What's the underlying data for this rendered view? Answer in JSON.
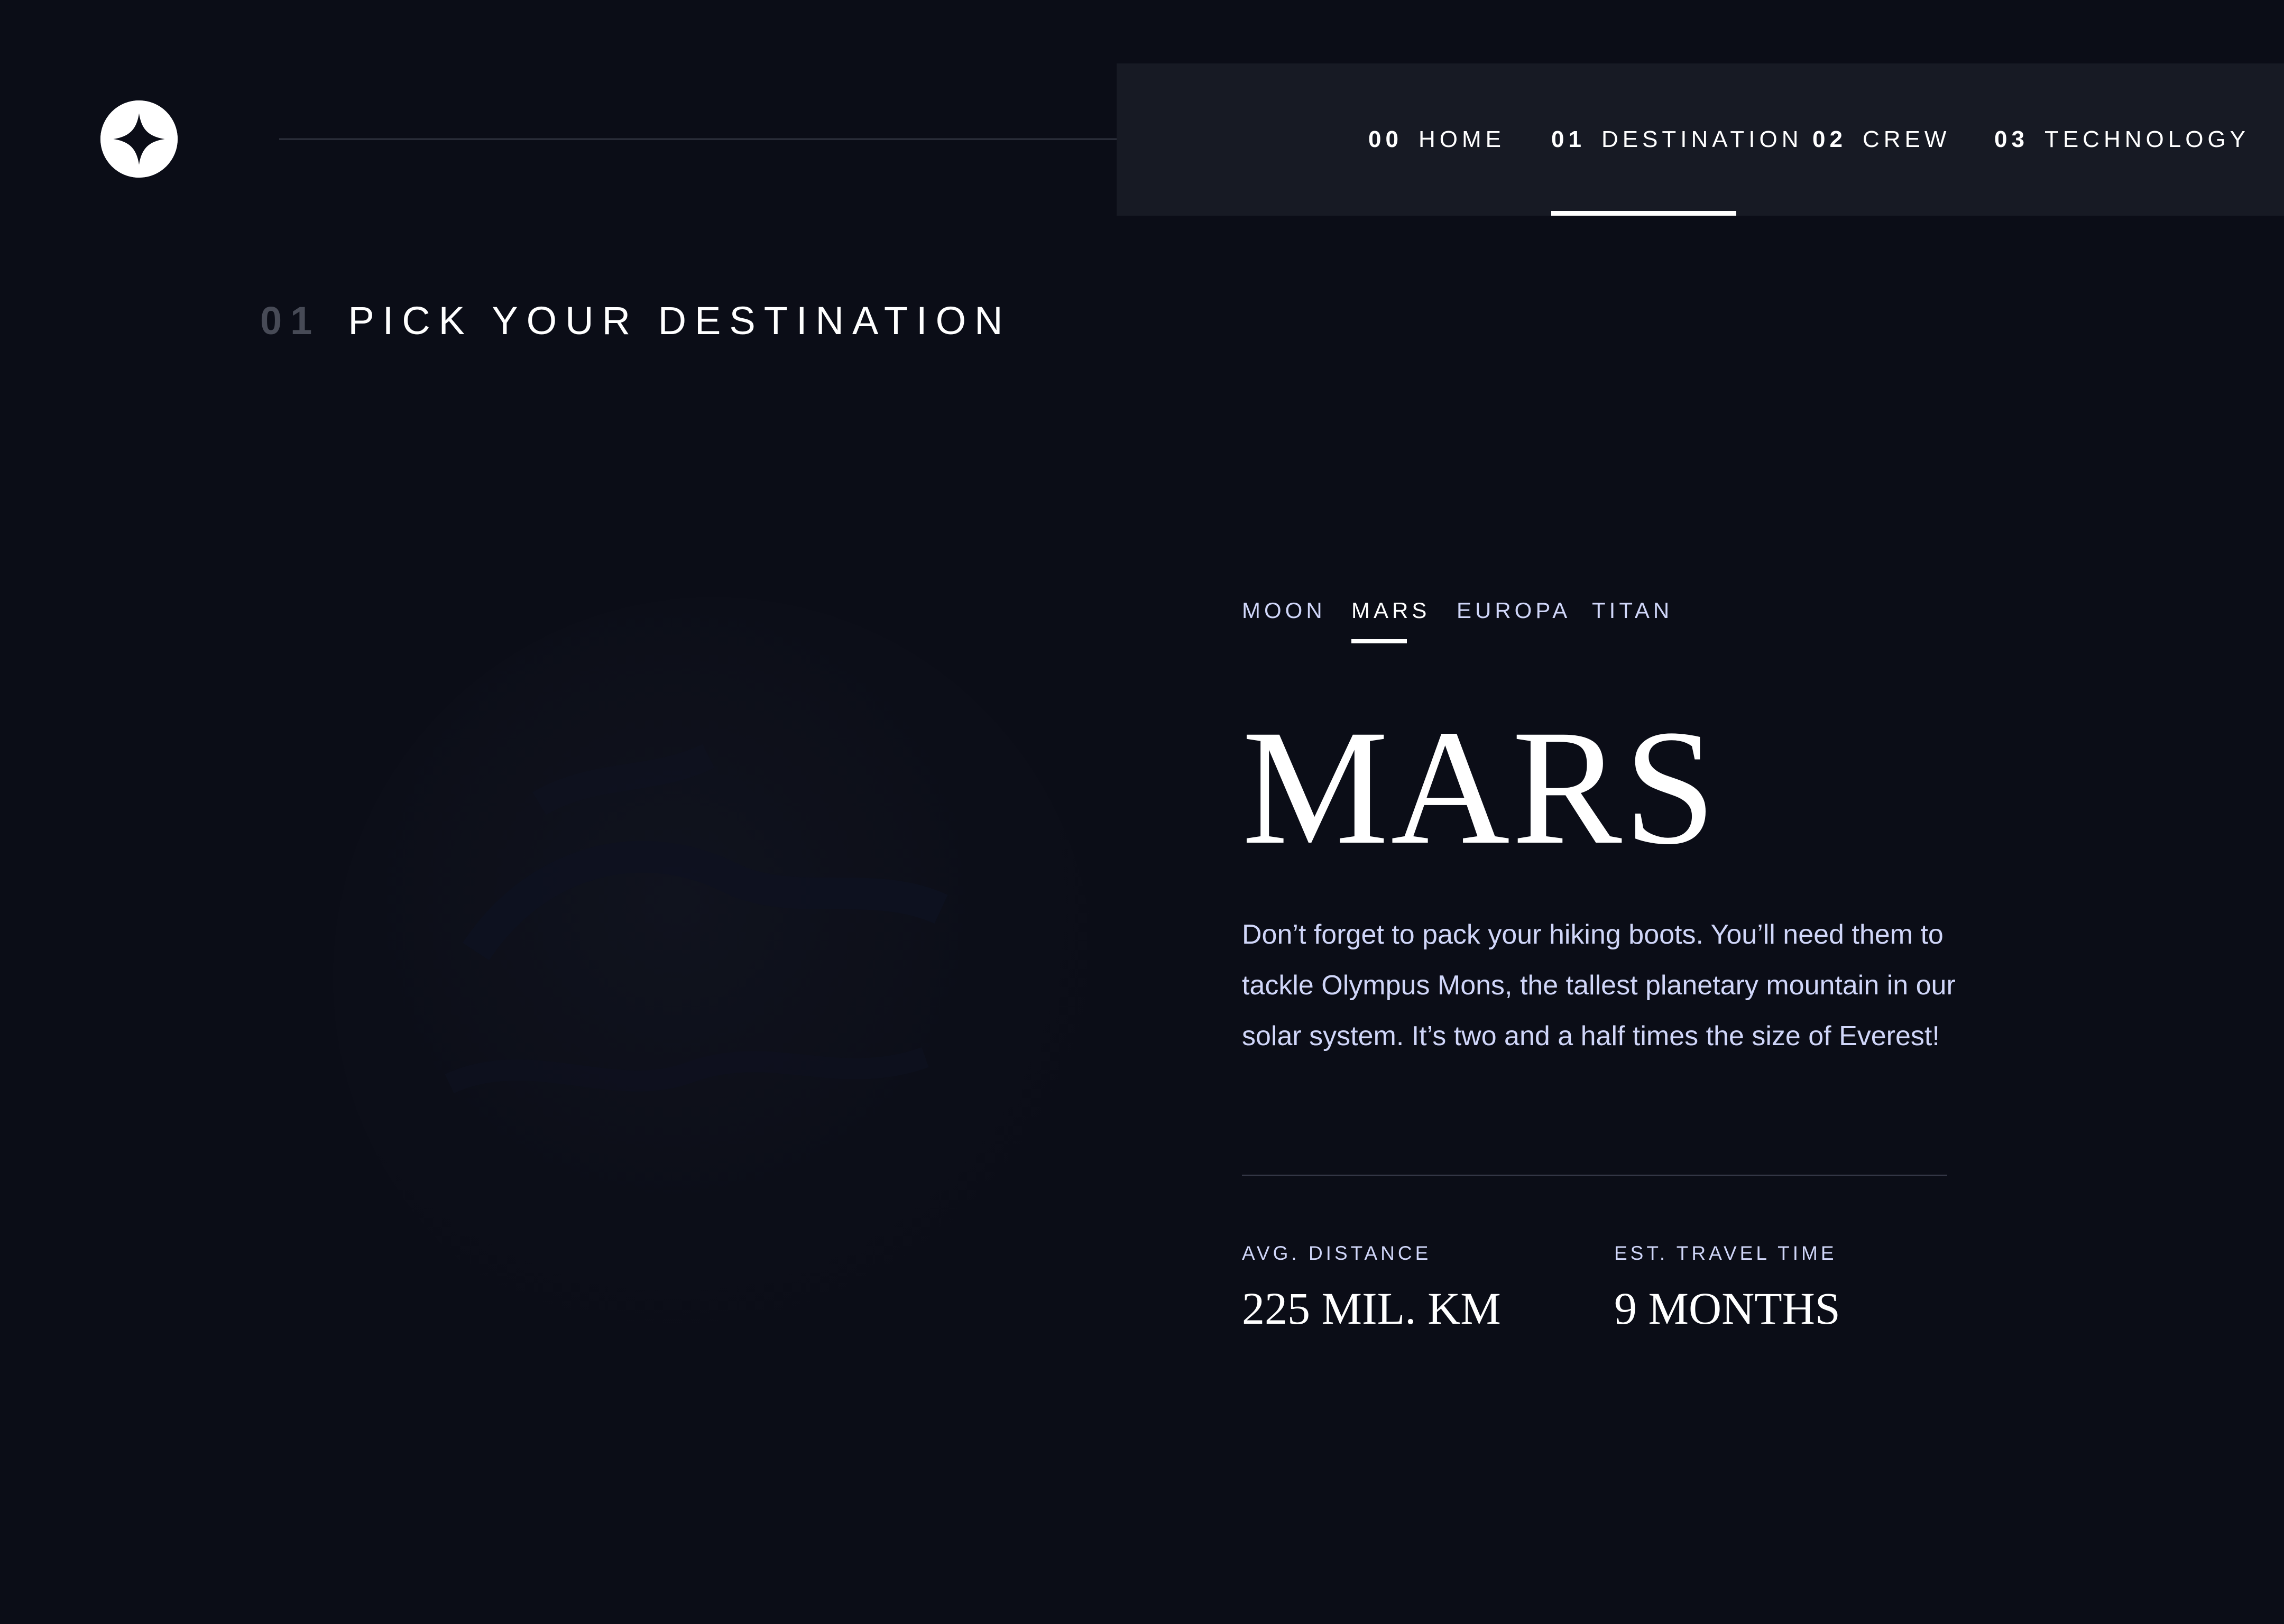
{
  "brand": {
    "logo_icon": "star-logo-icon"
  },
  "nav": {
    "items": [
      {
        "number": "00",
        "label": "HOME",
        "active": false
      },
      {
        "number": "01",
        "label": "DESTINATION",
        "active": true
      },
      {
        "number": "02",
        "label": "CREW",
        "active": false
      },
      {
        "number": "03",
        "label": "TECHNOLOGY",
        "active": false
      }
    ]
  },
  "section": {
    "number": "01",
    "title": "PICK YOUR DESTINATION"
  },
  "planet": {
    "image_icon": "mars-planet-image"
  },
  "tabs": {
    "items": [
      "MOON",
      "MARS",
      "EUROPA",
      "TITAN"
    ],
    "active": "MARS"
  },
  "destination": {
    "name": "MARS",
    "description": "Don’t forget to pack your hiking boots. You’ll need them to tackle Olympus Mons, the tallest planetary mountain in our solar system. It’s two and a half times the size of Everest!",
    "stats": [
      {
        "label": "AVG. DISTANCE",
        "value": "225 MIL. KM"
      },
      {
        "label": "EST. TRAVEL TIME",
        "value": "9 MONTHS"
      }
    ]
  },
  "colors": {
    "background": "#0b0d17",
    "nav_background": "#171a24",
    "accent_text": "#d0d6f9",
    "white": "#ffffff"
  }
}
